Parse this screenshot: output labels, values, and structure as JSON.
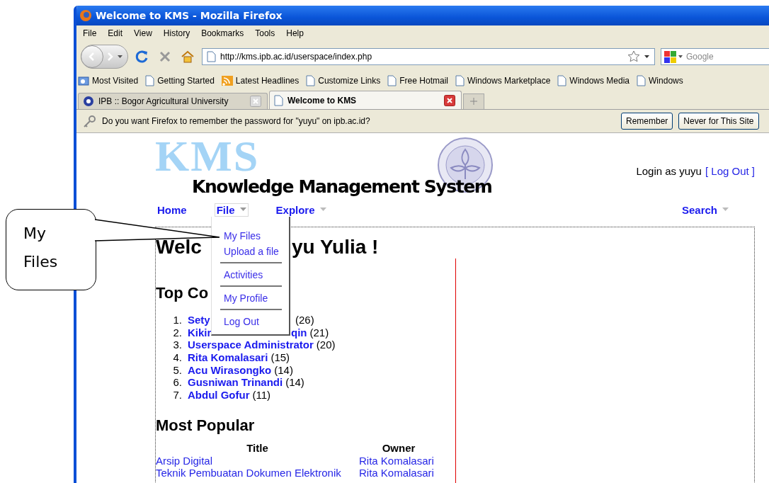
{
  "window": {
    "title": "Welcome to KMS - Mozilla Firefox"
  },
  "menu_bar": [
    "File",
    "Edit",
    "View",
    "History",
    "Bookmarks",
    "Tools",
    "Help"
  ],
  "address_bar": {
    "value": "http://kms.ipb.ac.id/userspace/index.php"
  },
  "search_field": {
    "placeholder": "Google"
  },
  "bookmarks": [
    {
      "label": "Most Visited",
      "kind": "folder"
    },
    {
      "label": "Getting Started",
      "kind": "page"
    },
    {
      "label": "Latest Headlines",
      "kind": "feed"
    },
    {
      "label": "Customize Links",
      "kind": "page"
    },
    {
      "label": "Free Hotmail",
      "kind": "page"
    },
    {
      "label": "Windows Marketplace",
      "kind": "page"
    },
    {
      "label": "Windows Media",
      "kind": "page"
    },
    {
      "label": "Windows",
      "kind": "page"
    }
  ],
  "tabs": [
    {
      "label": "IPB :: Bogor Agricultural University",
      "selected": false
    },
    {
      "label": "Welcome to KMS",
      "selected": true
    }
  ],
  "notification": {
    "message": "Do you want Firefox to remember the password for \"yuyu\" on ipb.ac.id?",
    "buttons": [
      "Remember",
      "Never for This Site"
    ]
  },
  "site": {
    "logo_letters": "KMS",
    "logo_title": "Knowledge Management System",
    "login_text": "Login as yuyu",
    "logout_link": "[ Log Out ]",
    "nav": [
      {
        "label": "Home",
        "caret": false,
        "open": false
      },
      {
        "label": "File",
        "caret": true,
        "open": true
      },
      {
        "label": "Explore",
        "caret": true,
        "open": false
      },
      {
        "label": "Search",
        "caret": true,
        "open": false
      }
    ],
    "file_menu": [
      [
        "My Files",
        "Upload a file"
      ],
      [
        "Activities"
      ],
      [
        "My Profile"
      ],
      [
        "Log Out"
      ]
    ],
    "welcome_heading": [
      "Welc",
      "yu Yulia !"
    ],
    "top_heading": "Top Co",
    "top_contributors": [
      {
        "number": "1.",
        "name_start": "Sety",
        "count": "(26)"
      },
      {
        "number": "2.",
        "name_start": "Kikir",
        "name_end": "qin",
        "count": "(21)"
      },
      {
        "number": "3.",
        "name": "Userspace Administrator",
        "count": "(20)"
      },
      {
        "number": "4.",
        "name": "Rita Komalasari",
        "count": "(15)"
      },
      {
        "number": "5.",
        "name": "Acu Wirasongko",
        "count": "(14)"
      },
      {
        "number": "6.",
        "name": "Gusniwan Trinandi",
        "count": "(14)"
      },
      {
        "number": "7.",
        "name": "Abdul Gofur",
        "count": "(11)"
      }
    ],
    "popular_heading": "Most Popular",
    "popular_table": {
      "columns": [
        "Title",
        "Owner"
      ],
      "rows": [
        [
          "Arsip Digital",
          "Rita Komalasari"
        ],
        [
          "Teknik Pembuatan Dokumen Elektronik",
          "Rita Komalasari"
        ]
      ]
    }
  },
  "callout": {
    "text": "My Files"
  }
}
